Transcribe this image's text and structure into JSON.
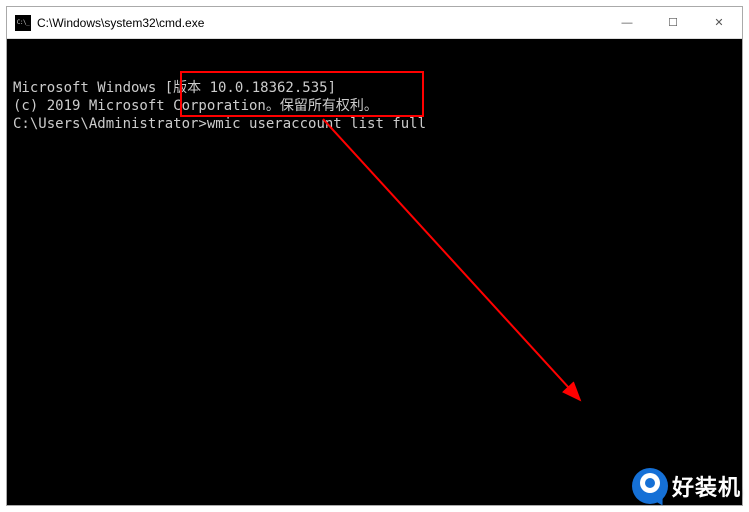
{
  "window": {
    "title": "C:\\Windows\\system32\\cmd.exe"
  },
  "terminal": {
    "line1": "Microsoft Windows [版本 10.0.18362.535]",
    "line2": "(c) 2019 Microsoft Corporation。保留所有权利。",
    "blank": "",
    "prompt": "C:\\Users\\Administrator>",
    "command": "wmic useraccount list full"
  },
  "watermark": {
    "text": "好装机"
  },
  "controls": {
    "minimize": "—",
    "maximize": "☐",
    "close": "✕"
  }
}
